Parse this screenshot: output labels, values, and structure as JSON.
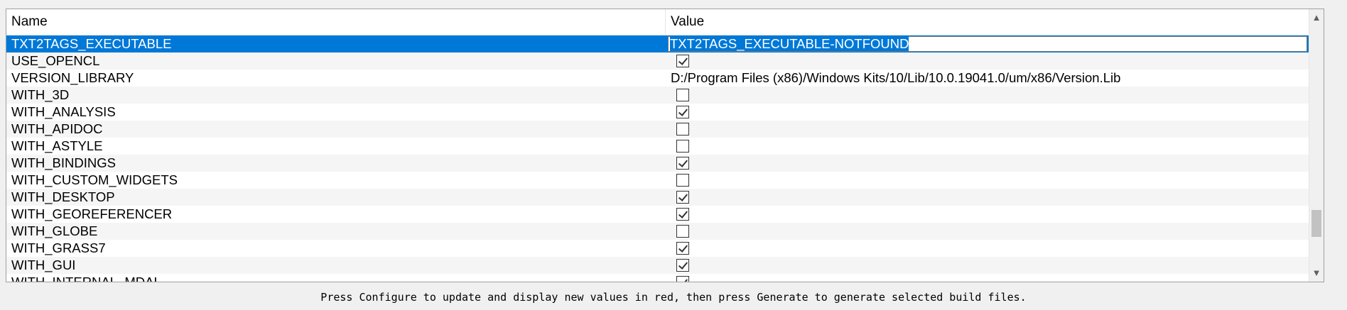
{
  "table": {
    "columns": {
      "name": "Name",
      "value": "Value"
    },
    "rows": [
      {
        "name": "TXT2TAGS_EXECUTABLE",
        "type": "path",
        "value": "TXT2TAGS_EXECUTABLE-NOTFOUND",
        "selected": true,
        "browse_label": "..."
      },
      {
        "name": "USE_OPENCL",
        "type": "bool",
        "checked": true
      },
      {
        "name": "VERSION_LIBRARY",
        "type": "text",
        "value": "D:/Program Files (x86)/Windows Kits/10/Lib/10.0.19041.0/um/x86/Version.Lib"
      },
      {
        "name": "WITH_3D",
        "type": "bool",
        "checked": false
      },
      {
        "name": "WITH_ANALYSIS",
        "type": "bool",
        "checked": true
      },
      {
        "name": "WITH_APIDOC",
        "type": "bool",
        "checked": false
      },
      {
        "name": "WITH_ASTYLE",
        "type": "bool",
        "checked": false
      },
      {
        "name": "WITH_BINDINGS",
        "type": "bool",
        "checked": true
      },
      {
        "name": "WITH_CUSTOM_WIDGETS",
        "type": "bool",
        "checked": false
      },
      {
        "name": "WITH_DESKTOP",
        "type": "bool",
        "checked": true
      },
      {
        "name": "WITH_GEOREFERENCER",
        "type": "bool",
        "checked": true
      },
      {
        "name": "WITH_GLOBE",
        "type": "bool",
        "checked": false
      },
      {
        "name": "WITH_GRASS7",
        "type": "bool",
        "checked": true
      },
      {
        "name": "WITH_GUI",
        "type": "bool",
        "checked": true
      },
      {
        "name": "WITH_INTERNAL_MDAL",
        "type": "bool",
        "checked": true
      }
    ]
  },
  "scrollbar": {
    "up_icon": "chevron-up-icon",
    "down_icon": "chevron-down-icon",
    "position": 0.87
  },
  "status": {
    "text": "Press Configure to update and display new values in red, then press Generate to generate selected build files."
  },
  "colors": {
    "selection": "#0078d7",
    "alt_row": "#f5f5f5"
  }
}
